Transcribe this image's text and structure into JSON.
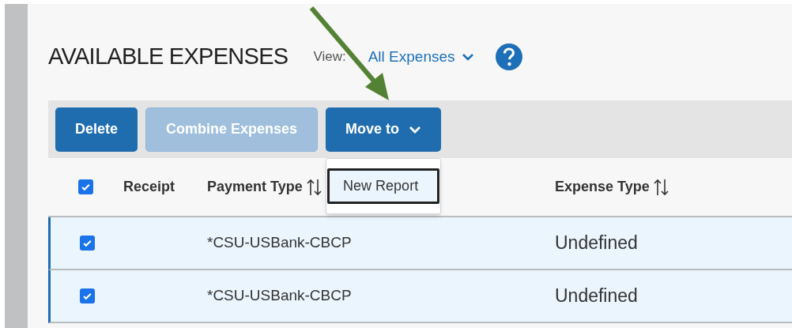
{
  "title": "AVAILABLE EXPENSES",
  "view": {
    "label": "View:",
    "value": "All Expenses"
  },
  "toolbar": [
    {
      "label": "Delete",
      "disabled": false,
      "menu": false
    },
    {
      "label": "Combine Expenses",
      "disabled": true,
      "menu": false
    },
    {
      "label": "Move to",
      "disabled": false,
      "menu": true
    }
  ],
  "menu": {
    "items": [
      {
        "label": "New Report",
        "selected": true
      }
    ]
  },
  "table": {
    "select_all": {
      "checked": true
    },
    "columns": [
      {
        "label": "Receipt",
        "sortable": false
      },
      {
        "label": "Payment Type",
        "sortable": true
      },
      {
        "label": "Expense Type",
        "sortable": true
      }
    ],
    "rows": [
      {
        "checked": true,
        "receipt": "",
        "payment_type": "*CSU-USBank-CBCP",
        "expense_type": "Undefined"
      },
      {
        "checked": true,
        "receipt": "",
        "payment_type": "*CSU-USBank-CBCP",
        "expense_type": "Undefined"
      }
    ]
  }
}
